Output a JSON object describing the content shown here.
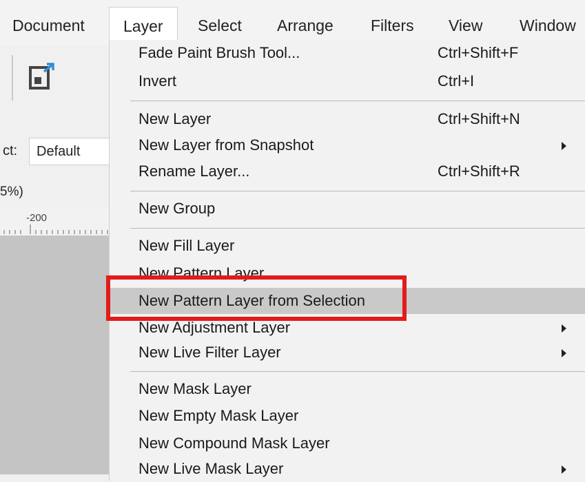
{
  "menubar": {
    "items": [
      "Document",
      "Layer",
      "Select",
      "Arrange",
      "Filters",
      "View",
      "Window"
    ],
    "active": "Layer"
  },
  "toolbar": {
    "export_icon": "export-icon",
    "preset_label": "ct:",
    "preset_value": "Default",
    "zoom_label": "5%)",
    "ruler_tick": "-200"
  },
  "layer_menu": {
    "fade_paint_brush": {
      "label": "Fade Paint Brush Tool...",
      "shortcut": "Ctrl+Shift+F"
    },
    "invert": {
      "label": "Invert",
      "shortcut": "Ctrl+I"
    },
    "new_layer": {
      "label": "New Layer",
      "shortcut": "Ctrl+Shift+N"
    },
    "new_layer_from_snapshot": {
      "label": "New Layer from Snapshot"
    },
    "rename_layer": {
      "label": "Rename Layer...",
      "shortcut": "Ctrl+Shift+R"
    },
    "new_group": {
      "label": "New Group"
    },
    "new_fill_layer": {
      "label": "New Fill Layer"
    },
    "new_pattern_layer": {
      "label": "New Pattern Layer"
    },
    "new_pattern_layer_from_selection": {
      "label": "New Pattern Layer from Selection"
    },
    "new_adjustment_layer": {
      "label": "New Adjustment Layer"
    },
    "new_live_filter_layer": {
      "label": "New Live Filter Layer"
    },
    "new_mask_layer": {
      "label": "New Mask Layer"
    },
    "new_empty_mask_layer": {
      "label": "New Empty Mask Layer"
    },
    "new_compound_mask_layer": {
      "label": "New Compound Mask Layer"
    },
    "new_live_mask_layer": {
      "label": "New Live Mask Layer"
    }
  },
  "colors": {
    "highlight": "#c9c9c9",
    "callout": "#e31b1b"
  }
}
